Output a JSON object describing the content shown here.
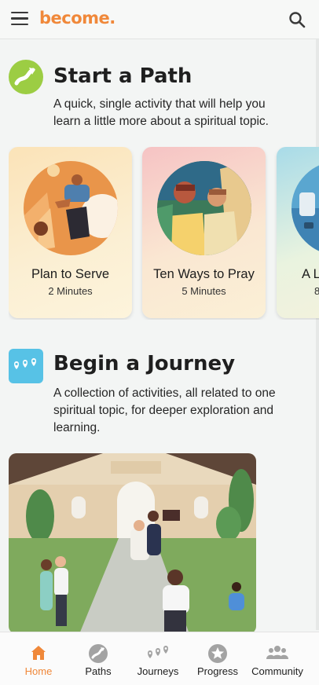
{
  "app": {
    "logo": "become."
  },
  "colors": {
    "accent": "#f0883a",
    "path_green": "#9ccd43",
    "journey_blue": "#57c2e6",
    "background": "#f3f5f4"
  },
  "icons": {
    "menu": "hamburger-menu-icon",
    "search": "search-icon",
    "path": "path-arrow-icon",
    "journey": "journey-pins-icon"
  },
  "path_section": {
    "title": "Start a Path",
    "description_line1": "A quick, single activity that will help you",
    "description_line2": "learn a little more about a spiritual topic.",
    "cards": [
      {
        "title": "Plan to Serve",
        "duration": "2 Minutes"
      },
      {
        "title": "Ten Ways to Pray",
        "duration": "5 Minutes"
      },
      {
        "title": "A L",
        "duration": "8"
      }
    ]
  },
  "journey_section": {
    "title": "Begin a Journey",
    "description_line1": "A collection of activities, all related to one",
    "description_line2": "spiritual topic, for deeper exploration and",
    "description_line3": "learning."
  },
  "bottom_nav": {
    "items": [
      {
        "label": "Home",
        "icon": "home-icon",
        "active": true
      },
      {
        "label": "Paths",
        "icon": "paths-icon",
        "active": false
      },
      {
        "label": "Journeys",
        "icon": "journeys-icon",
        "active": false
      },
      {
        "label": "Progress",
        "icon": "progress-star-icon",
        "active": false
      },
      {
        "label": "Community",
        "icon": "community-icon",
        "active": false
      }
    ]
  }
}
